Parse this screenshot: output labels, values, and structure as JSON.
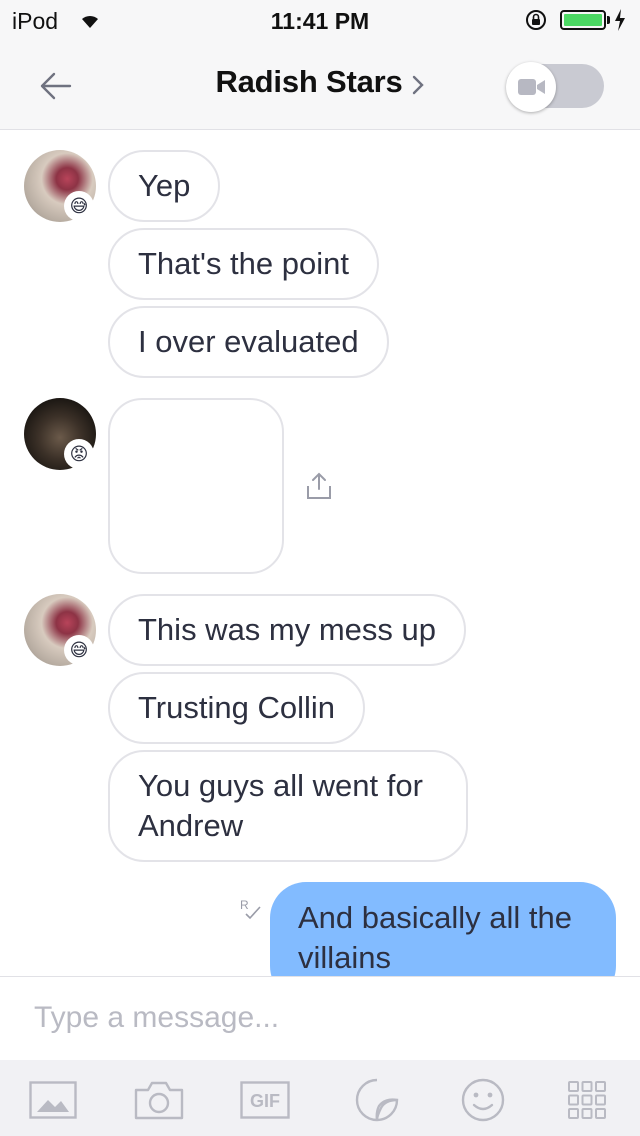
{
  "status_bar": {
    "carrier": "iPod",
    "time": "11:41 PM"
  },
  "nav": {
    "title": "Radish Stars"
  },
  "messages": [
    {
      "sender_badge": "😅",
      "bubbles": [
        "Yep",
        "That's the point",
        "I over evaluated"
      ]
    },
    {
      "sender_badge": "😡",
      "bubbles": []
    },
    {
      "sender_badge": "😅",
      "bubbles": [
        "This was my mess up",
        "Trusting Collin",
        "You guys all went for Andrew"
      ]
    }
  ],
  "outgoing": {
    "text": "And basically all the villains",
    "read_marker": "R"
  },
  "composer": {
    "placeholder": "Type a message..."
  },
  "toolbar": {
    "gif_label": "GIF"
  },
  "colors": {
    "outgoing_bubble": "#82bbff",
    "incoming_border": "#e3e3e8",
    "battery": "#4cd964",
    "icon_gray": "#b9bac3"
  }
}
